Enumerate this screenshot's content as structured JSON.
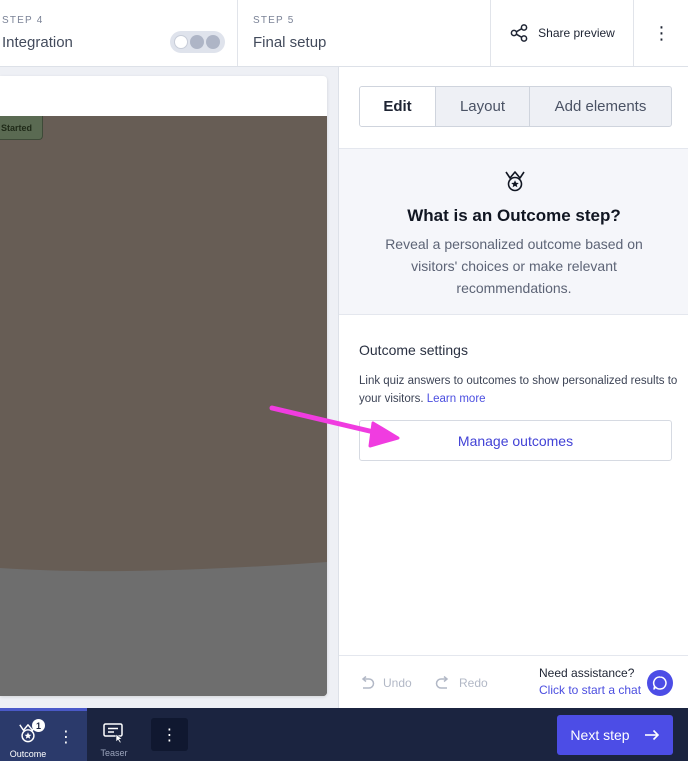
{
  "header": {
    "step4": {
      "number": "STEP 4",
      "title": "Integration"
    },
    "step5": {
      "number": "STEP 5",
      "title": "Final setup"
    },
    "share_label": "Share preview",
    "more_glyph": "⋮"
  },
  "preview": {
    "started_label": "Started"
  },
  "panel": {
    "tabs": [
      {
        "label": "Edit",
        "active": true
      },
      {
        "label": "Layout"
      },
      {
        "label": "Add elements"
      }
    ],
    "info": {
      "icon": "outcome-crown-icon",
      "title": "What is an Outcome step?",
      "description": "Reveal a personalized outcome based on visitors' choices or make relevant recommendations."
    },
    "settings": {
      "title": "Outcome settings",
      "description": "Link quiz answers to outcomes to show personalized results to your visitors.",
      "learn_more": "Learn more",
      "manage_button": "Manage outcomes"
    },
    "bottom": {
      "undo": "Undo",
      "redo": "Redo",
      "assist_question": "Need assistance?",
      "assist_link": "Click to start a chat"
    }
  },
  "footer": {
    "outcome_label": "Outcome",
    "outcome_badge": "1",
    "teaser_label": "Teaser",
    "more_glyph": "⋮",
    "next_label": "Next step"
  },
  "colors": {
    "accent": "#4c4de6",
    "annotation_arrow": "#f03ce0",
    "footer_bg": "#1b2440",
    "preview_bg": "#675d55"
  }
}
